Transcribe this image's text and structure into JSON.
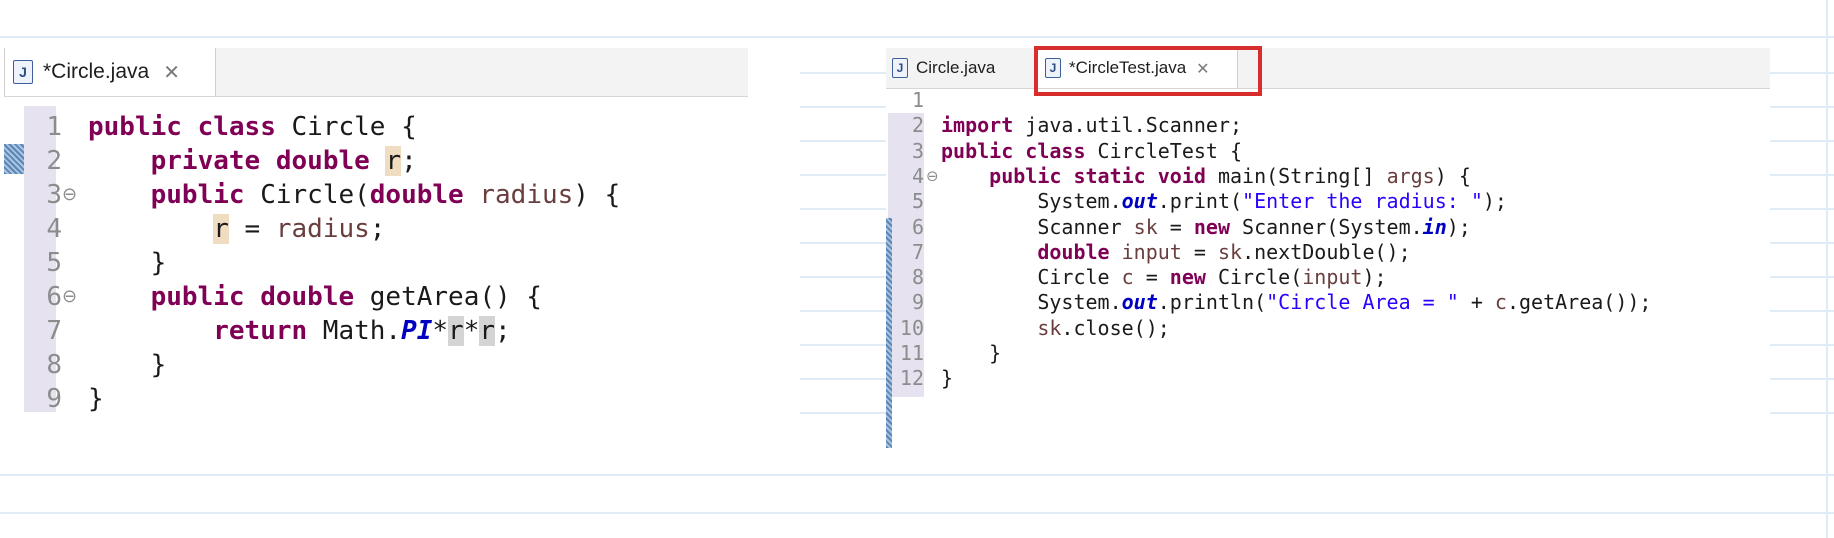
{
  "left_editor": {
    "tab": {
      "label": "*Circle.java",
      "icon": "java-file-icon"
    },
    "lines": [
      {
        "num": "1",
        "code": [
          {
            "t": "public",
            "c": "kw"
          },
          {
            "t": " "
          },
          {
            "t": "class",
            "c": "kw"
          },
          {
            "t": " Circle {"
          }
        ]
      },
      {
        "num": "2",
        "code": [
          {
            "t": "    "
          },
          {
            "t": "private",
            "c": "kw"
          },
          {
            "t": " "
          },
          {
            "t": "double",
            "c": "kw"
          },
          {
            "t": " "
          },
          {
            "t": "r",
            "c": "occ"
          },
          {
            "t": ";"
          }
        ]
      },
      {
        "num": "3",
        "fold": true,
        "code": [
          {
            "t": "    "
          },
          {
            "t": "public",
            "c": "kw"
          },
          {
            "t": " Circle("
          },
          {
            "t": "double",
            "c": "kw"
          },
          {
            "t": " "
          },
          {
            "t": "radius",
            "c": "var"
          },
          {
            "t": ") {"
          }
        ]
      },
      {
        "num": "4",
        "code": [
          {
            "t": "        "
          },
          {
            "t": "r",
            "c": "occ"
          },
          {
            "t": " = "
          },
          {
            "t": "radius",
            "c": "var"
          },
          {
            "t": ";"
          }
        ]
      },
      {
        "num": "5",
        "code": [
          {
            "t": "    }"
          }
        ]
      },
      {
        "num": "6",
        "fold": true,
        "code": [
          {
            "t": "    "
          },
          {
            "t": "public",
            "c": "kw"
          },
          {
            "t": " "
          },
          {
            "t": "double",
            "c": "kw"
          },
          {
            "t": " getArea() {"
          }
        ]
      },
      {
        "num": "7",
        "code": [
          {
            "t": "        "
          },
          {
            "t": "return",
            "c": "kw"
          },
          {
            "t": " Math."
          },
          {
            "t": "PI",
            "c": "fld"
          },
          {
            "t": "*"
          },
          {
            "t": "r",
            "c": "occ2"
          },
          {
            "t": "*"
          },
          {
            "t": "r",
            "c": "occ2"
          },
          {
            "t": ";"
          }
        ]
      },
      {
        "num": "8",
        "code": [
          {
            "t": "    }"
          }
        ]
      },
      {
        "num": "9",
        "code": [
          {
            "t": "}"
          }
        ]
      }
    ]
  },
  "right_editor": {
    "tabs": [
      {
        "label": "Circle.java",
        "icon": "java-file-icon",
        "active": false
      },
      {
        "label": "*CircleTest.java",
        "icon": "java-file-icon",
        "active": true,
        "close_icon": "close-icon"
      }
    ],
    "lines": [
      {
        "num": "1",
        "code": []
      },
      {
        "num": "2",
        "code": [
          {
            "t": "import",
            "c": "kw"
          },
          {
            "t": " java.util.Scanner;"
          }
        ]
      },
      {
        "num": "3",
        "code": [
          {
            "t": "public",
            "c": "kw"
          },
          {
            "t": " "
          },
          {
            "t": "class",
            "c": "kw"
          },
          {
            "t": " CircleTest {"
          }
        ]
      },
      {
        "num": "4",
        "fold": true,
        "code": [
          {
            "t": "    "
          },
          {
            "t": "public",
            "c": "kw"
          },
          {
            "t": " "
          },
          {
            "t": "static",
            "c": "kw"
          },
          {
            "t": " "
          },
          {
            "t": "void",
            "c": "kw"
          },
          {
            "t": " main(String[] "
          },
          {
            "t": "args",
            "c": "var"
          },
          {
            "t": ") {"
          }
        ]
      },
      {
        "num": "5",
        "code": [
          {
            "t": "        System."
          },
          {
            "t": "out",
            "c": "fld"
          },
          {
            "t": ".print("
          },
          {
            "t": "\"Enter the radius: \"",
            "c": "str"
          },
          {
            "t": ");"
          }
        ]
      },
      {
        "num": "6",
        "code": [
          {
            "t": "        Scanner "
          },
          {
            "t": "sk",
            "c": "var"
          },
          {
            "t": " = "
          },
          {
            "t": "new",
            "c": "kw"
          },
          {
            "t": " Scanner(System."
          },
          {
            "t": "in",
            "c": "fld"
          },
          {
            "t": ");"
          }
        ]
      },
      {
        "num": "7",
        "code": [
          {
            "t": "        "
          },
          {
            "t": "double",
            "c": "kw"
          },
          {
            "t": " "
          },
          {
            "t": "input",
            "c": "var"
          },
          {
            "t": " = "
          },
          {
            "t": "sk",
            "c": "var"
          },
          {
            "t": ".nextDouble();"
          }
        ]
      },
      {
        "num": "8",
        "code": [
          {
            "t": "        Circle "
          },
          {
            "t": "c",
            "c": "var"
          },
          {
            "t": " = "
          },
          {
            "t": "new",
            "c": "kw"
          },
          {
            "t": " Circle("
          },
          {
            "t": "input",
            "c": "var"
          },
          {
            "t": ");"
          }
        ]
      },
      {
        "num": "9",
        "code": [
          {
            "t": "        System."
          },
          {
            "t": "out",
            "c": "fld"
          },
          {
            "t": ".println("
          },
          {
            "t": "\"Circle Area = \"",
            "c": "str"
          },
          {
            "t": " + "
          },
          {
            "t": "c",
            "c": "var"
          },
          {
            "t": ".getArea());"
          }
        ]
      },
      {
        "num": "10",
        "code": [
          {
            "t": "        "
          },
          {
            "t": "sk",
            "c": "var"
          },
          {
            "t": ".close();"
          }
        ]
      },
      {
        "num": "11",
        "code": [
          {
            "t": "    }"
          }
        ]
      },
      {
        "num": "12",
        "code": [
          {
            "t": "}"
          }
        ]
      }
    ]
  },
  "colors": {
    "keyword": "#7f0055",
    "field": "#0000c0",
    "string": "#2a00ff",
    "highlight_box": "#d82d2d"
  }
}
